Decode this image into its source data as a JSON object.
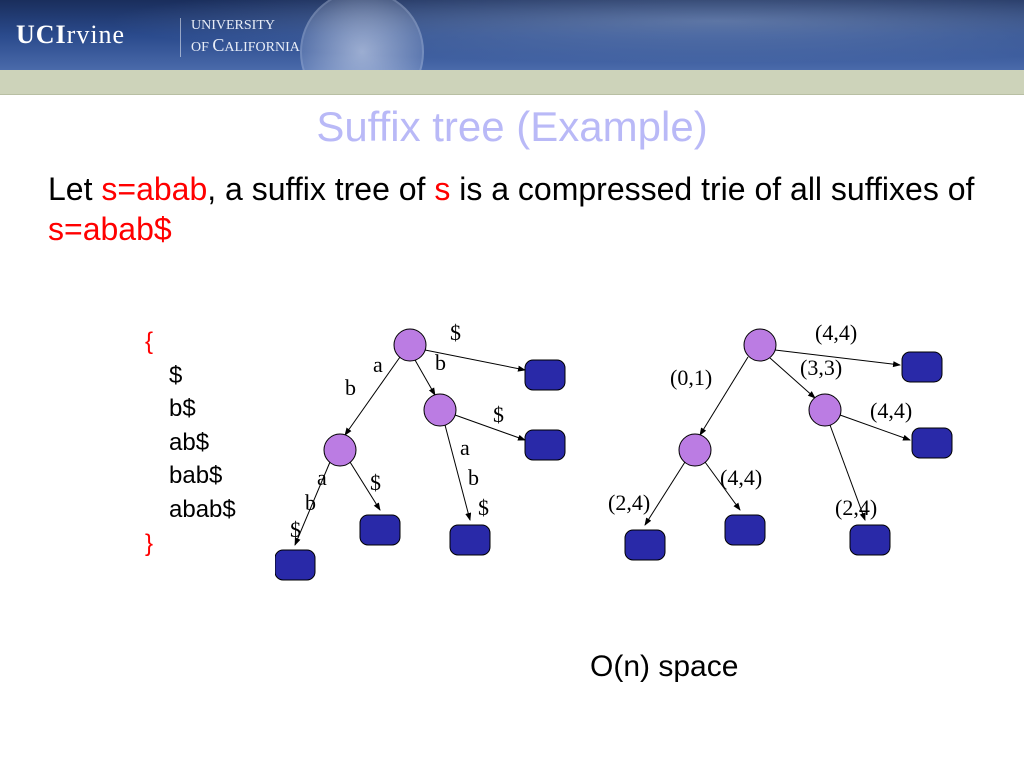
{
  "banner": {
    "logo_main": "UCIrvine",
    "logo_sub_line1": "UNIVERSITY",
    "logo_sub_line2_prefix": "OF ",
    "logo_sub_line2_cap": "C",
    "logo_sub_line2_rest": "ALIFORNIA"
  },
  "slide": {
    "title": "Suffix tree (Example)",
    "sentence_pre": "Let ",
    "sentence_s1": "s=abab",
    "sentence_mid": ", a suffix tree of ",
    "sentence_s2": "s",
    "sentence_mid2": " is a compressed trie of all suffixes of ",
    "sentence_s3": "s=abab$",
    "suffixes": {
      "open": "{",
      "s1": "$",
      "s2": "b$",
      "s3": "ab$",
      "s4": "bab$",
      "s5": "abab$",
      "close": "}"
    },
    "footnote": "O(n) space"
  },
  "tree1": {
    "edges": {
      "root_dollar": "$",
      "root_a": "a",
      "root_left_b": "b",
      "root_b": "b",
      "b_dollar": "$",
      "b_a": "a",
      "b_b": "b",
      "b_b_dollar": "$",
      "ab_a": "a",
      "ab_b": "b",
      "ab_dollar": "$",
      "abab_dollar": "$"
    }
  },
  "tree2": {
    "edges": {
      "root_44": "(4,4)",
      "root_01": "(0,1)",
      "root_33": "(3,3)",
      "r_44": "(4,4)",
      "r_24": "(2,4)",
      "l_24": "(2,4)",
      "l_44": "(4,4)"
    }
  }
}
